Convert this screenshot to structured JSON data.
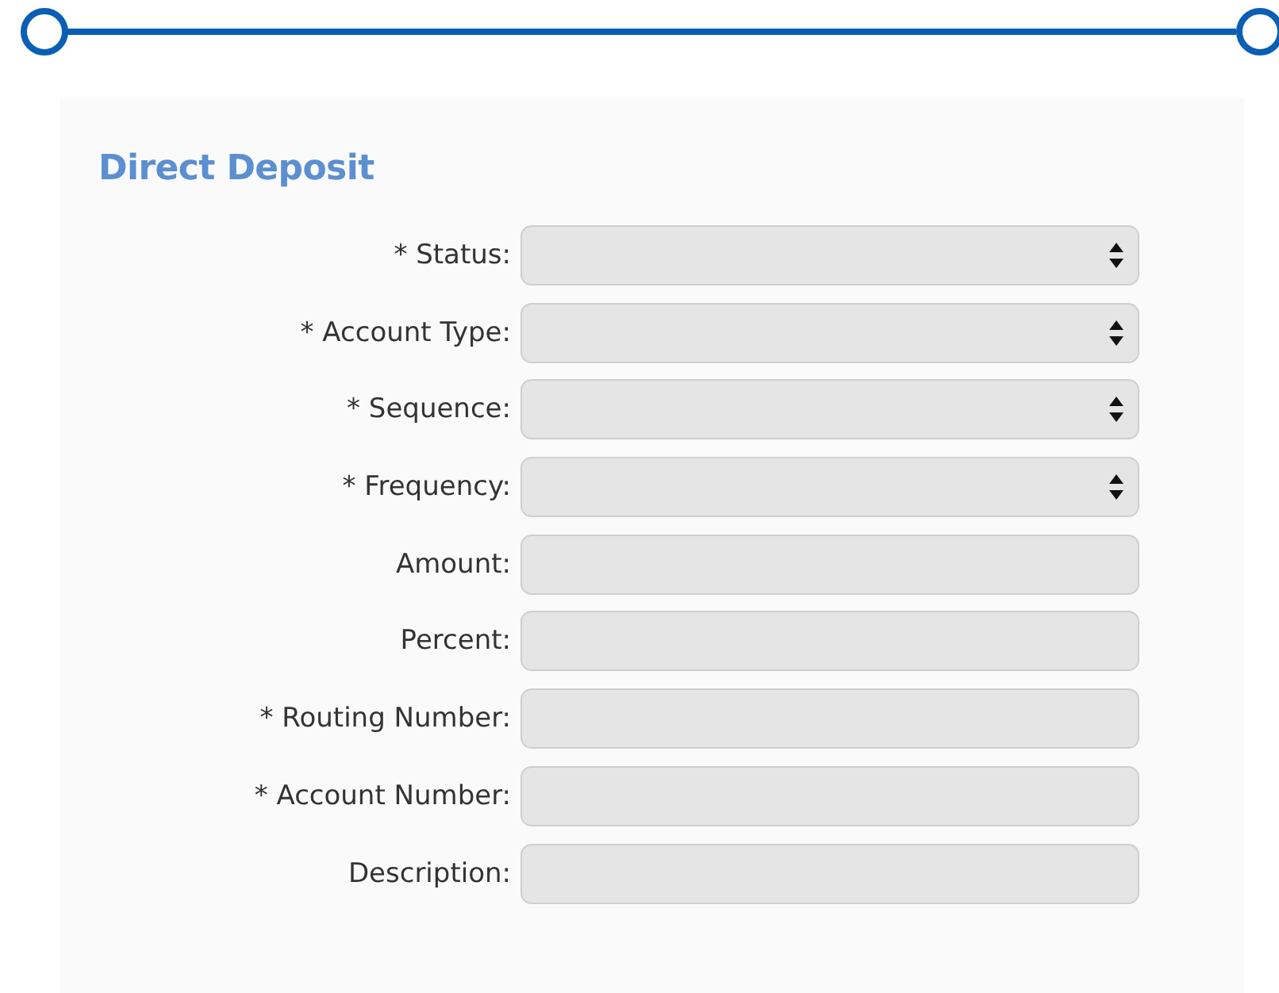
{
  "section": {
    "title": "Direct Deposit"
  },
  "fields": [
    {
      "label": "* Status:",
      "kind": "select"
    },
    {
      "label": "* Account Type:",
      "kind": "select"
    },
    {
      "label": "* Sequence:",
      "kind": "select"
    },
    {
      "label": "* Frequency:",
      "kind": "select"
    },
    {
      "label": "Amount:",
      "kind": "text"
    },
    {
      "label": "Percent:",
      "kind": "text"
    },
    {
      "label": "* Routing Number:",
      "kind": "text"
    },
    {
      "label": "* Account Number:",
      "kind": "text"
    },
    {
      "label": "Description:",
      "kind": "text"
    }
  ]
}
